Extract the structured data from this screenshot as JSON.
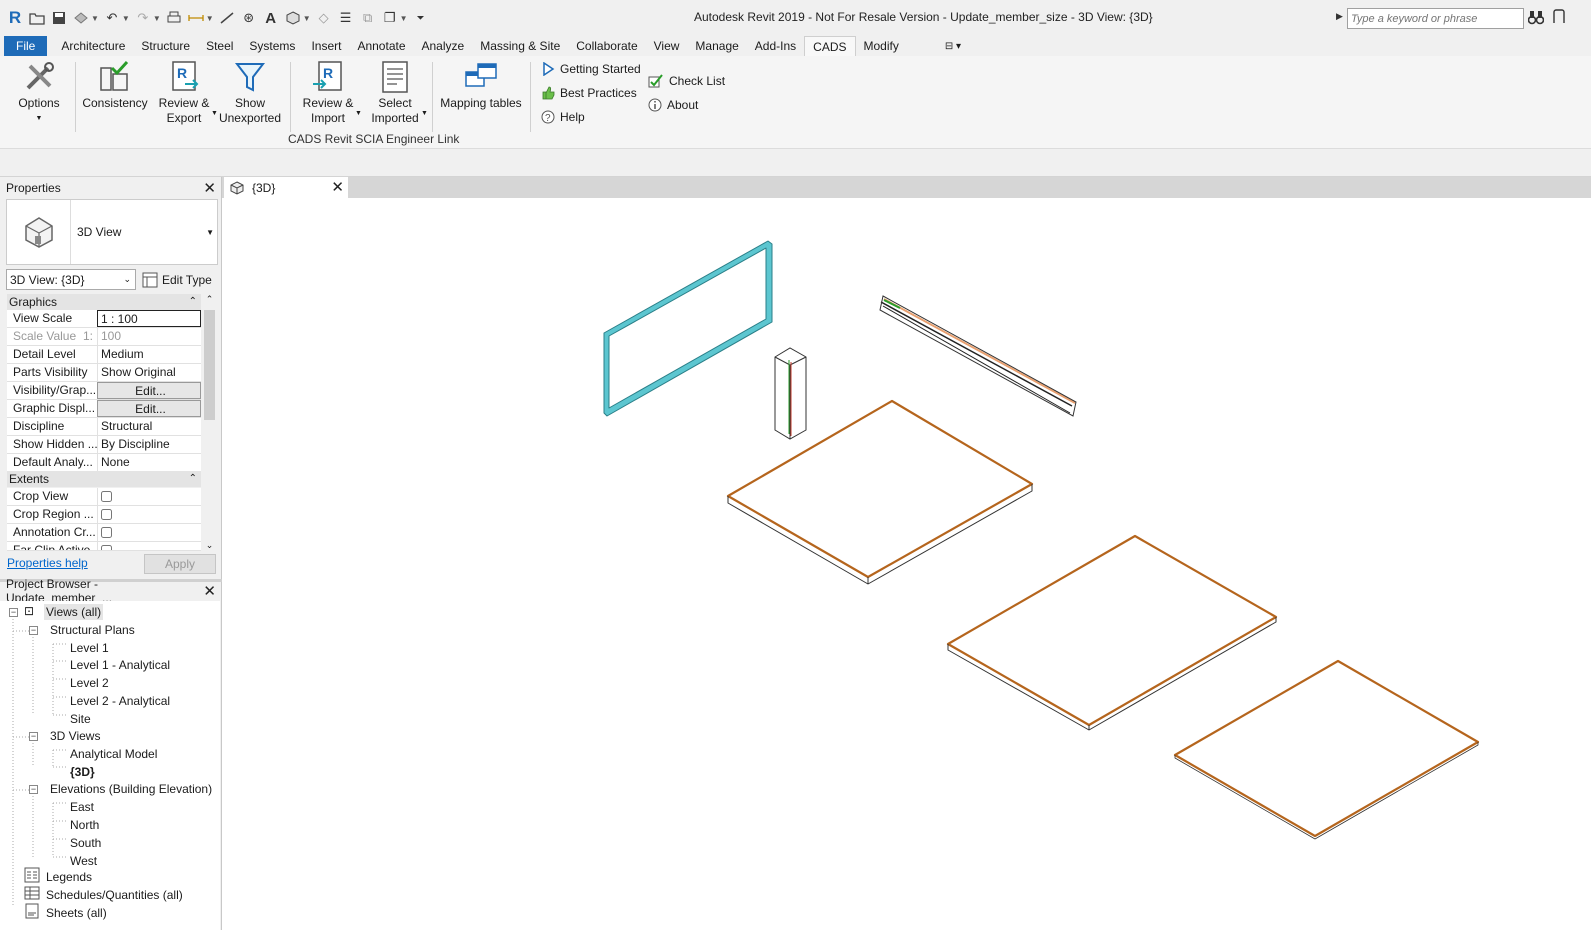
{
  "title_bar": {
    "app_title": "Autodesk Revit 2019 - Not For Resale Version - Update_member_size - 3D View: {3D}",
    "search_placeholder": "Type a keyword or phrase"
  },
  "menu": {
    "items": [
      "File",
      "Architecture",
      "Structure",
      "Steel",
      "Systems",
      "Insert",
      "Annotate",
      "Analyze",
      "Massing & Site",
      "Collaborate",
      "View",
      "Manage",
      "Add-Ins",
      "CADS",
      "Modify"
    ],
    "active": "CADS"
  },
  "ribbon": {
    "options": "Options",
    "consistency": "Consistency",
    "review_export_1": "Review &",
    "review_export_2": "Export",
    "show_unexported_1": "Show",
    "show_unexported_2": "Unexported",
    "review_import_1": "Review &",
    "review_import_2": "Import",
    "select_imported_1": "Select",
    "select_imported_2": "Imported",
    "mapping_tables": "Mapping tables",
    "getting_started": "Getting Started",
    "best_practices": "Best Practices",
    "help": "Help",
    "check_list": "Check List",
    "about": "About",
    "panel_label": "CADS Revit SCIA Engineer Link"
  },
  "properties": {
    "header": "Properties",
    "type_name": "3D View",
    "view_selector": "3D View: {3D}",
    "edit_type": "Edit Type",
    "groups": {
      "graphics": "Graphics",
      "extents": "Extents"
    },
    "rows": {
      "view_scale": {
        "key": "View Scale",
        "value": "1 : 100"
      },
      "scale_value": {
        "key": "Scale Value",
        "unit": "1:",
        "value": "100"
      },
      "detail_level": {
        "key": "Detail Level",
        "value": "Medium"
      },
      "parts_visibility": {
        "key": "Parts Visibility",
        "value": "Show Original"
      },
      "visibility_graphics": {
        "key": "Visibility/Grap...",
        "value": "Edit..."
      },
      "graphic_display": {
        "key": "Graphic Displ...",
        "value": "Edit..."
      },
      "discipline": {
        "key": "Discipline",
        "value": "Structural"
      },
      "show_hidden": {
        "key": "Show Hidden ...",
        "value": "By Discipline"
      },
      "default_analysis": {
        "key": "Default Analy...",
        "value": "None"
      },
      "crop_view": {
        "key": "Crop View"
      },
      "crop_region": {
        "key": "Crop Region ..."
      },
      "annotation_crop": {
        "key": "Annotation Cr..."
      },
      "far_clip": {
        "key": "Far Clip Active"
      }
    },
    "help_link": "Properties help",
    "apply": "Apply"
  },
  "project_browser": {
    "header": "Project Browser - Update_member_...",
    "views_all": "Views (all)",
    "structural_plans": "Structural Plans",
    "level_1": "Level 1",
    "level_1_analytical": "Level 1 - Analytical",
    "level_2": "Level 2",
    "level_2_analytical": "Level 2 - Analytical",
    "site": "Site",
    "views_3d": "3D Views",
    "analytical_model": "Analytical Model",
    "view_3d": "{3D}",
    "elevations": "Elevations (Building Elevation)",
    "east": "East",
    "north": "North",
    "south": "South",
    "west": "West",
    "legends": "Legends",
    "schedules": "Schedules/Quantities (all)",
    "sheets": "Sheets (all)"
  },
  "view_tab": {
    "label": "{3D}"
  },
  "colors": {
    "accent": "#1e6bb8",
    "wall": "#5cc6d0",
    "slab_edge": "#b5651d",
    "link": "#0066cc"
  }
}
